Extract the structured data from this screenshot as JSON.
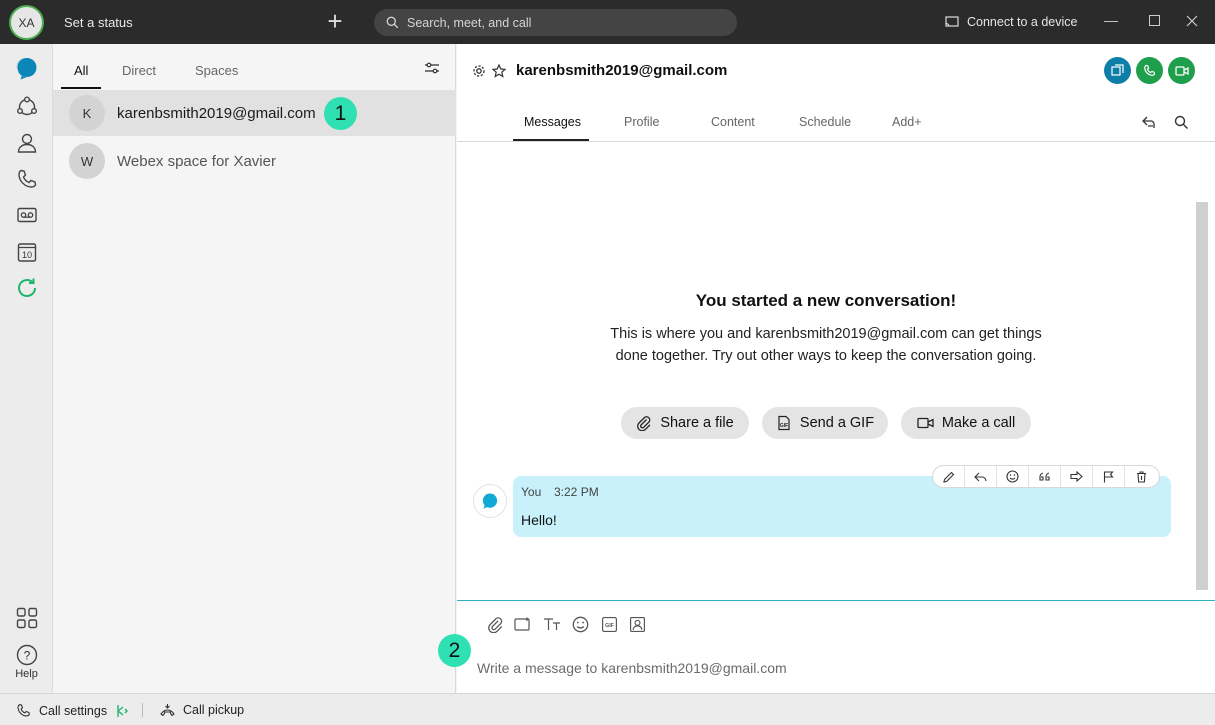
{
  "titlebar": {
    "avatar_initials": "XA",
    "status_text": "Set a status",
    "search_placeholder": "Search, meet, and call",
    "connect_label": "Connect to a device"
  },
  "rail": {
    "help_label": "Help",
    "calendar_day": "10"
  },
  "list": {
    "tabs": [
      {
        "label": "All",
        "active": true
      },
      {
        "label": "Direct",
        "active": false
      },
      {
        "label": "Spaces",
        "active": false
      }
    ],
    "conversations": [
      {
        "initial": "K",
        "name": "karenbsmith2019@gmail.com",
        "selected": true
      },
      {
        "initial": "W",
        "name": "Webex space for Xavier",
        "selected": false
      }
    ]
  },
  "annotations": {
    "step1": "1",
    "step2": "2",
    "color": "#2fe0b3"
  },
  "main": {
    "title": "karenbsmith2019@gmail.com",
    "tabs": [
      {
        "label": "Messages",
        "active": true
      },
      {
        "label": "Profile",
        "active": false
      },
      {
        "label": "Content",
        "active": false
      },
      {
        "label": "Schedule",
        "active": false
      },
      {
        "label": "Add+",
        "active": false
      }
    ],
    "empty_state": {
      "title": "You started a new conversation!",
      "description": "This is where you and karenbsmith2019@gmail.com can get things done together. Try out other ways to keep the conversation going.",
      "actions": [
        "Share a file",
        "Send a GIF",
        "Make a call"
      ]
    },
    "message": {
      "sender": "You",
      "time": "3:22 PM",
      "text": "Hello!"
    },
    "composer_placeholder": "Write a message to karenbsmith2019@gmail.com"
  },
  "bottombar": {
    "call_settings": "Call settings",
    "call_pickup": "Call pickup"
  },
  "colors": {
    "titlebar_bg": "#2b2b2b",
    "bubble_bg": "#c8f1fb",
    "accent_blue": "#0e7fa8",
    "call_green": "#1f9e4b"
  }
}
